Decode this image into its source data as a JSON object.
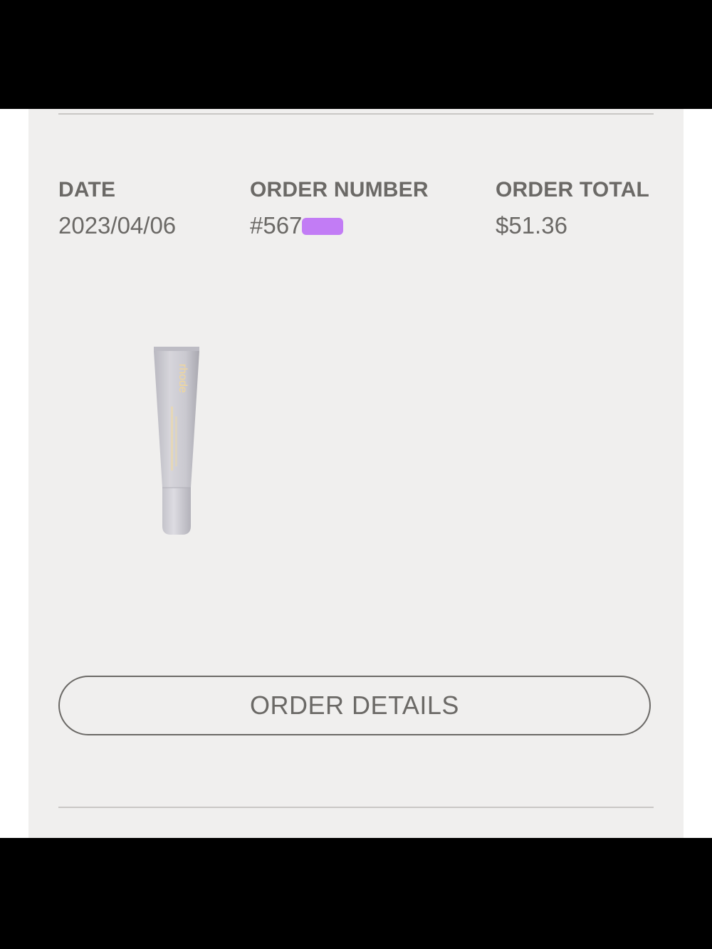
{
  "order": {
    "date_label": "DATE",
    "date_value": "2023/04/06",
    "number_label": "ORDER NUMBER",
    "number_value": "#567",
    "total_label": "ORDER TOTAL",
    "total_value": "$51.36"
  },
  "product": {
    "brand_text": "rhode",
    "icon": "lip-tube-product-image"
  },
  "actions": {
    "order_details_label": "ORDER DETAILS"
  },
  "colors": {
    "card_background": "#f0efee",
    "text": "#6b6966",
    "redaction": "#c27cf5",
    "tube": "#c9c8cf",
    "brand_text": "#f2d79a"
  }
}
